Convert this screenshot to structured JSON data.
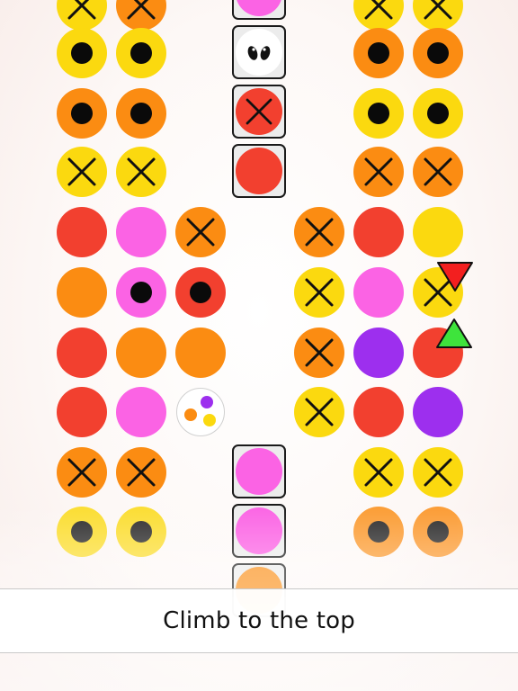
{
  "banner": {
    "text": "Climb to the top"
  },
  "colors": {
    "red": "#f2402f",
    "orange": "#fb8c12",
    "yellow": "#fbd90f",
    "pink": "#fb63e4",
    "purple": "#9d2fee",
    "marker_red": "#f31f1f",
    "marker_green": "#3ee43c"
  },
  "board": {
    "left_pillar": [
      [
        "yellow-cross",
        "orange-cross"
      ],
      [
        "yellow-eye",
        "yellow-eye"
      ],
      [
        "orange-eye",
        "orange-eye"
      ],
      [
        "yellow-cross",
        "yellow-cross"
      ],
      [
        "red",
        "pink",
        "orange-cross"
      ],
      [
        "orange",
        "pink-eye",
        "red-eye"
      ],
      [
        "red",
        "orange",
        "orange"
      ],
      [
        "red",
        "pink",
        "mixed"
      ],
      [
        "orange-cross",
        "orange-cross"
      ],
      [
        "yellow-eye",
        "yellow-eye"
      ]
    ],
    "right_pillar": [
      [
        "yellow-cross",
        "yellow-cross"
      ],
      [
        "orange-eye",
        "orange-eye"
      ],
      [
        "yellow-eye",
        "yellow-eye"
      ],
      [
        "orange-cross",
        "orange-cross"
      ],
      [
        "orange-cross",
        "red",
        "yellow"
      ],
      [
        "yellow-cross",
        "pink",
        "yellow-cross"
      ],
      [
        "orange-cross",
        "purple",
        "red"
      ],
      [
        "yellow-cross",
        "red",
        "purple"
      ],
      [
        "yellow-cross",
        "yellow-cross"
      ],
      [
        "orange-eye",
        "orange-eye"
      ]
    ],
    "center_column_top": [
      "pink",
      "eyes",
      "red-cross",
      "red"
    ],
    "center_column_bottom": [
      "pink",
      "pink",
      "orange"
    ]
  },
  "player_markers": {
    "down_marker": "red triangle pointing down",
    "up_marker": "green triangle pointing up"
  }
}
